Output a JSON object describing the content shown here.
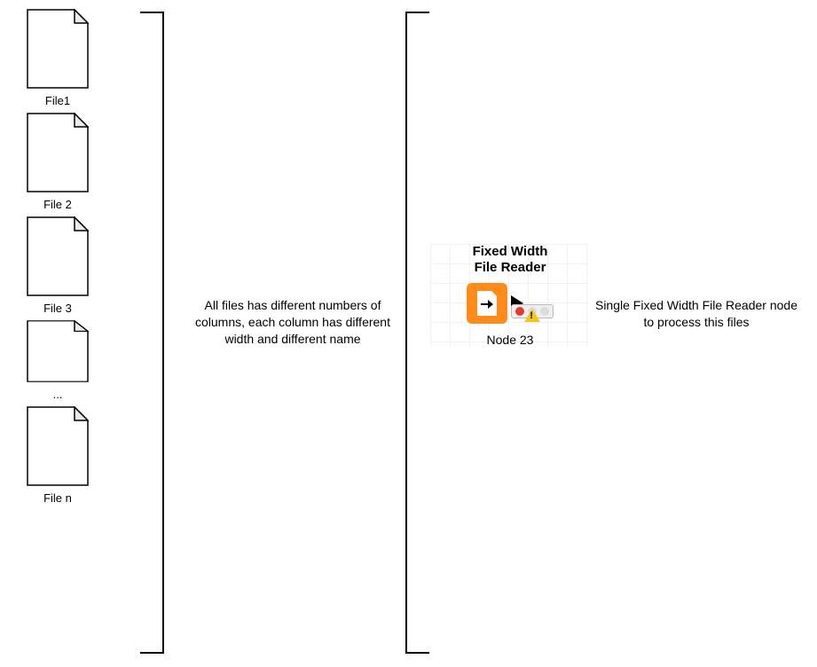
{
  "files": {
    "items": [
      {
        "label": "File1"
      },
      {
        "label": "File 2"
      },
      {
        "label": "File 3"
      }
    ],
    "ellipsis": "...",
    "last": {
      "label": "File n"
    }
  },
  "descriptions": {
    "left": "All files has different numbers of columns, each column has different width and different name",
    "right": "Single Fixed Width File Reader node to process this files"
  },
  "node": {
    "title_line1": "Fixed Width",
    "title_line2": "File Reader",
    "id": "Node 23",
    "status": "warning"
  }
}
